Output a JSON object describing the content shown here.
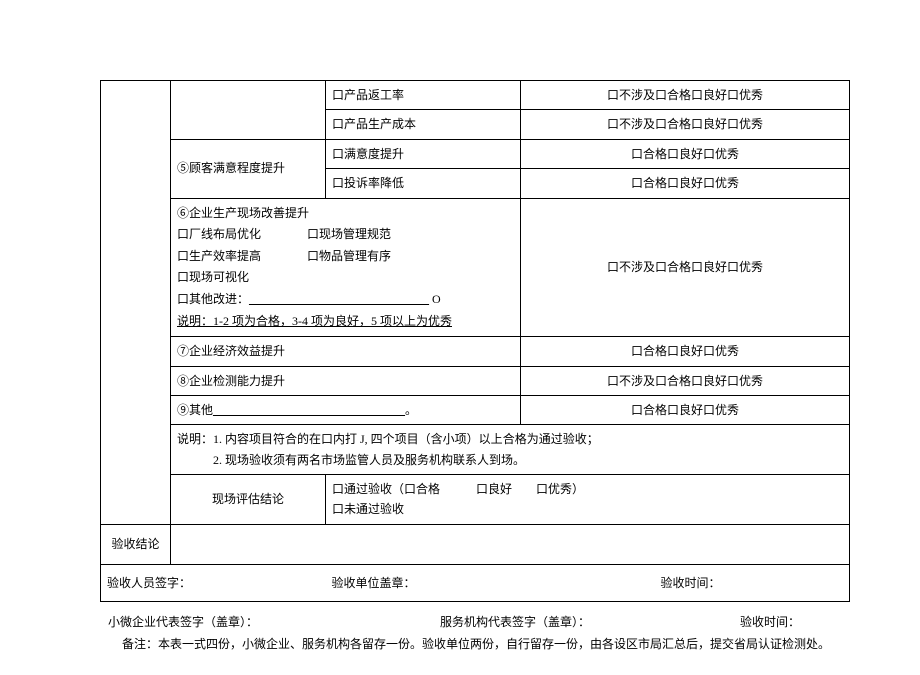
{
  "rows": {
    "r1_item": "口产品返工率",
    "r1_rating": "口不涉及口合格口良好口优秀",
    "r2_item": "口产品生产成本",
    "r2_rating": "口不涉及口合格口良好口优秀",
    "r3_label": "⑤顾客满意程度提升",
    "r3_item": "口满意度提升",
    "r3_rating": "口合格口良好口优秀",
    "r4_item": "口投诉率降低",
    "r4_rating": "口合格口良好口优秀",
    "section6_title": "⑥企业生产现场改善提升",
    "section6_a1": "口厂线布局优化",
    "section6_a2": "口现场管理规范",
    "section6_b1": "口生产效率提高",
    "section6_b2": "口物品管理有序",
    "section6_c": "口现场可视化",
    "section6_d_pre": "口其他改进：",
    "section6_d_line": "______________________________",
    "section6_d_suf": " O",
    "section6_note": "说明：1-2 项为合格，3-4 项为良好，5 项以上为优秀",
    "section6_rating": "口不涉及口合格口良好口优秀",
    "r7_label": "⑦企业经济效益提升",
    "r7_rating": "口合格口良好口优秀",
    "r8_label": "⑧企业检测能力提升",
    "r8_rating": "口不涉及口合格口良好口优秀",
    "r9_label_pre": "⑨其他",
    "r9_label_line": "________________________________",
    "r9_label_suf": "。",
    "r9_rating": "口合格口良好口优秀",
    "note_title": "说明：",
    "note_1": "1. 内容项目符合的在口内打 J, 四个项目（含小项）以上合格为通过验收；",
    "note_2": "2. 现场验收须有两名市场监管人员及服务机构联系人到场。",
    "eval_label": "现场评估结论",
    "eval_line1": "口通过验收（口合格   口良好  口优秀）",
    "eval_line2": "口未通过验收",
    "accept_label": "验收结论",
    "sig_a": "验收人员签字：",
    "sig_b": "验收单位盖章：",
    "sig_c": "验收时间：",
    "out_a": "小微企业代表签字（盖章）：",
    "out_b": "服务机构代表签字（盖章）：",
    "out_c": "验收时间：",
    "out_note": "备注：本表一式四份，小微企业、服务机构各留存一份。验收单位两份，自行留存一份，由各设区市局汇总后，提交省局认证检测处。"
  }
}
